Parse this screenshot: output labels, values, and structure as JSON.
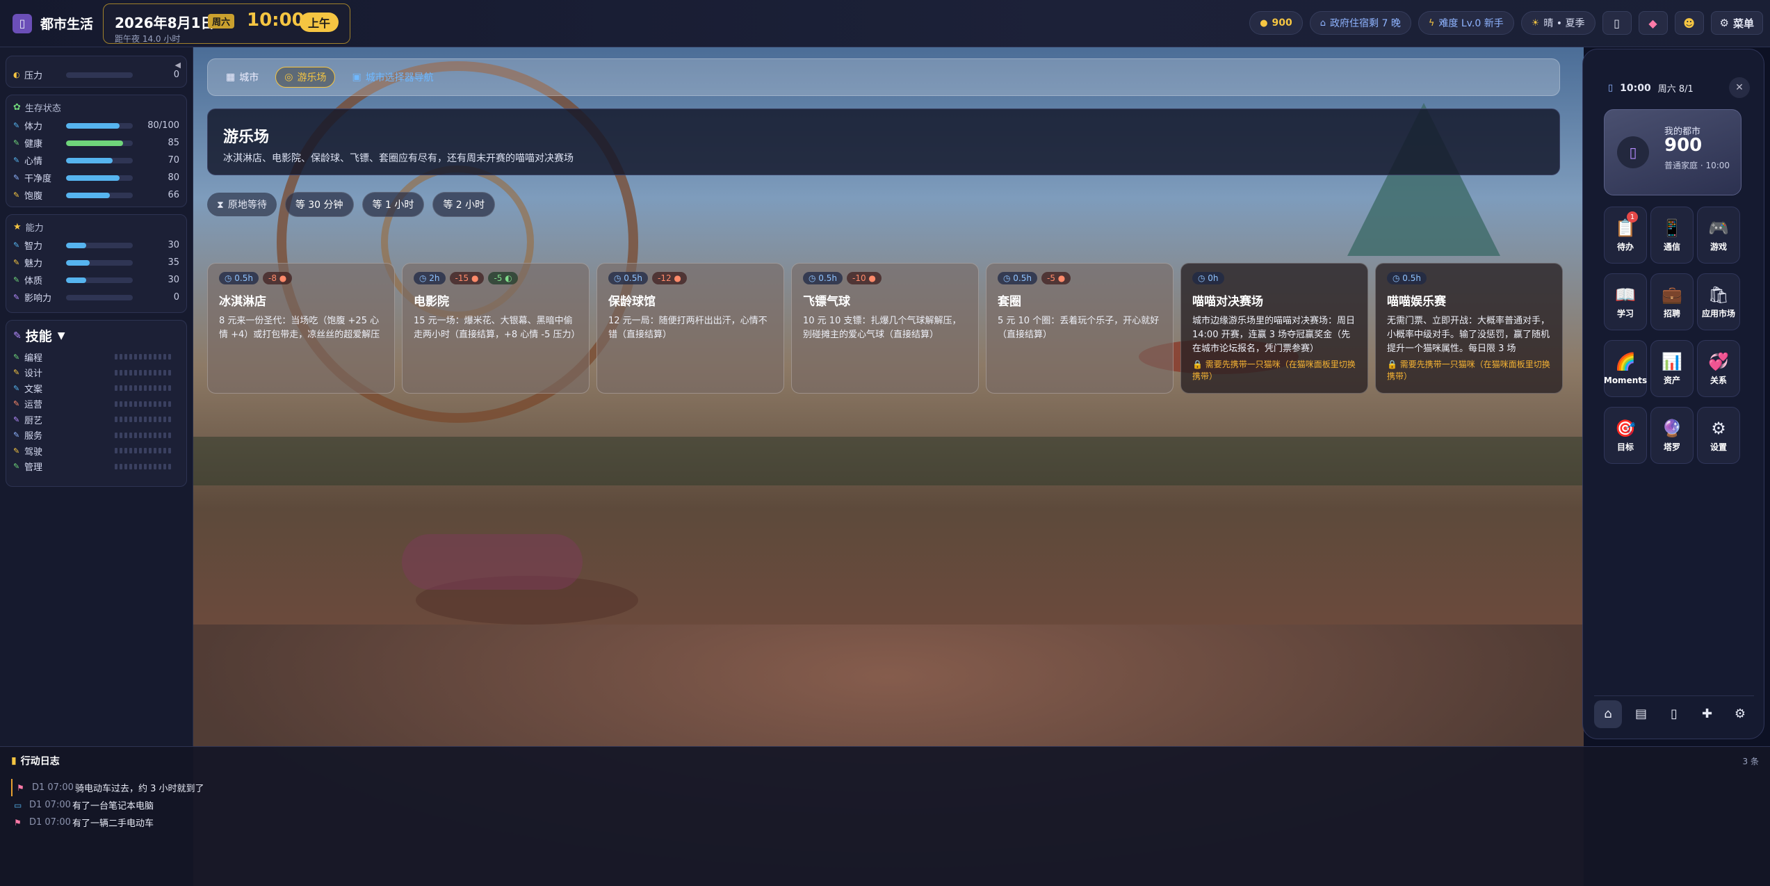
{
  "app": {
    "title": "都市生活",
    "logo_icon": "phone-icon"
  },
  "clock": {
    "date": "2026年8月1日",
    "weekday": "周六",
    "time": "10:00",
    "ampm": "上午",
    "sub": "距午夜 14.0 小时"
  },
  "topbar": {
    "money": "900",
    "housing": "政府住宿剩 7 晚",
    "difficulty": "难度 Lv.0 新手",
    "weather": "晴 • 夏季",
    "menu_label": "菜单"
  },
  "left": {
    "pressure": {
      "label": "压力",
      "value": "0"
    },
    "survival": {
      "title": "生存状态",
      "stats": [
        {
          "label": "体力",
          "value": "80/100",
          "fill": 0.8
        },
        {
          "label": "健康",
          "value": "85",
          "fill": 0.85
        },
        {
          "label": "心情",
          "value": "70",
          "fill": 0.7
        },
        {
          "label": "干净度",
          "value": "80",
          "fill": 0.8
        },
        {
          "label": "饱腹",
          "value": "66",
          "fill": 0.66
        }
      ]
    },
    "ability": {
      "title": "能力",
      "stats": [
        {
          "label": "智力",
          "value": "30",
          "fill": 0.3
        },
        {
          "label": "魅力",
          "value": "35",
          "fill": 0.35
        },
        {
          "label": "体质",
          "value": "30",
          "fill": 0.3
        },
        {
          "label": "影响力",
          "value": "0",
          "fill": 0
        }
      ]
    },
    "skills": {
      "title": "技能",
      "items": [
        "编程",
        "设计",
        "文案",
        "运营",
        "厨艺",
        "服务",
        "驾驶",
        "管理"
      ]
    }
  },
  "breadcrumb": {
    "items": [
      "城市",
      "游乐场",
      "城市选择器导航"
    ]
  },
  "location": {
    "title": "游乐场",
    "desc": "冰淇淋店、电影院、保龄球、飞镖、套圈应有尽有，还有周末开赛的喵喵对决赛场"
  },
  "wait": {
    "label": "原地等待",
    "options": [
      "等 30 分钟",
      "等 1 小时",
      "等 2 小时"
    ]
  },
  "cards": [
    {
      "title": "冰淇淋店",
      "time": "0.5h",
      "cost": "-8",
      "gain": "",
      "desc": "8 元来一份圣代：当场吃（饱腹 +25 心情 +4）或打包带走，凉丝丝的超爱解压",
      "warn": ""
    },
    {
      "title": "电影院",
      "time": "2h",
      "cost": "-15",
      "gain": "-5",
      "desc": "15 元一场：爆米花、大银幕、黑暗中偷走两小时（直接结算，+8 心情 -5 压力）",
      "warn": ""
    },
    {
      "title": "保龄球馆",
      "time": "0.5h",
      "cost": "-12",
      "gain": "",
      "desc": "12 元一局：随便打两杆出出汗，心情不错（直接结算）",
      "warn": ""
    },
    {
      "title": "飞镖气球",
      "time": "0.5h",
      "cost": "-10",
      "gain": "",
      "desc": "10 元 10 支镖：扎爆几个气球解解压，别碰摊主的爱心气球（直接结算）",
      "warn": ""
    },
    {
      "title": "套圈",
      "time": "0.5h",
      "cost": "-5",
      "gain": "",
      "desc": "5 元 10 个圈：丢着玩个乐子，开心就好（直接结算）",
      "warn": ""
    },
    {
      "title": "喵喵对决赛场",
      "time": "0h",
      "cost": "",
      "gain": "",
      "desc": "城市边缘游乐场里的喵喵对决赛场：周日 14:00 开赛，连赢 3 场夺冠赢奖金（先在城市论坛报名，凭门票参赛）",
      "warn": "需要先携带一只猫咪（在猫咪面板里切换携带）"
    },
    {
      "title": "喵喵娱乐赛",
      "time": "0.5h",
      "cost": "",
      "gain": "",
      "desc": "无需门票、立即开战：大概率普通对手，小概率中级对手。输了没惩罚，赢了随机提升一个猫咪属性。每日限 3 场",
      "warn": "需要先携带一只猫咪（在猫咪面板里切换携带）"
    }
  ],
  "phone": {
    "time": "10:00",
    "date": "周六 8/1",
    "card_label": "我的都市",
    "money": "900",
    "sub": "普通家庭 · 10:00",
    "badge_todo": "1",
    "apps": [
      {
        "label": "待办",
        "icon": "clipboard-icon",
        "glyph": "📋"
      },
      {
        "label": "通信",
        "icon": "phone-icon",
        "glyph": "📱"
      },
      {
        "label": "游戏",
        "icon": "gamepad-icon",
        "glyph": "🎮"
      },
      {
        "label": "学习",
        "icon": "book-icon",
        "glyph": "📖"
      },
      {
        "label": "招聘",
        "icon": "briefcase-icon",
        "glyph": "💼"
      },
      {
        "label": "应用市场",
        "icon": "store-bag-icon",
        "glyph": "🛍"
      },
      {
        "label": "Moments",
        "icon": "rainbow-icon",
        "glyph": "🌈"
      },
      {
        "label": "资产",
        "icon": "bar-chart-icon",
        "glyph": "📊"
      },
      {
        "label": "关系",
        "icon": "heart-icon",
        "glyph": "💞"
      },
      {
        "label": "目标",
        "icon": "target-icon",
        "glyph": "🎯"
      },
      {
        "label": "塔罗",
        "icon": "tarot-icon",
        "glyph": "🔮"
      },
      {
        "label": "设置",
        "icon": "gear-icon",
        "glyph": "⚙"
      }
    ]
  },
  "log": {
    "title": "行动日志",
    "count": "3 条",
    "entries": [
      {
        "time": "D1 07:00",
        "text": "骑电动车过去，约 3 小时就到了"
      },
      {
        "time": "D1 07:00",
        "text": "有了一台笔记本电脑"
      },
      {
        "time": "D1 07:00",
        "text": "有了一辆二手电动车"
      }
    ]
  },
  "colors": {
    "accent": "#f5c542",
    "bar": "#56b4ef",
    "health": "#6fd57a",
    "warn": "#f5b233"
  }
}
